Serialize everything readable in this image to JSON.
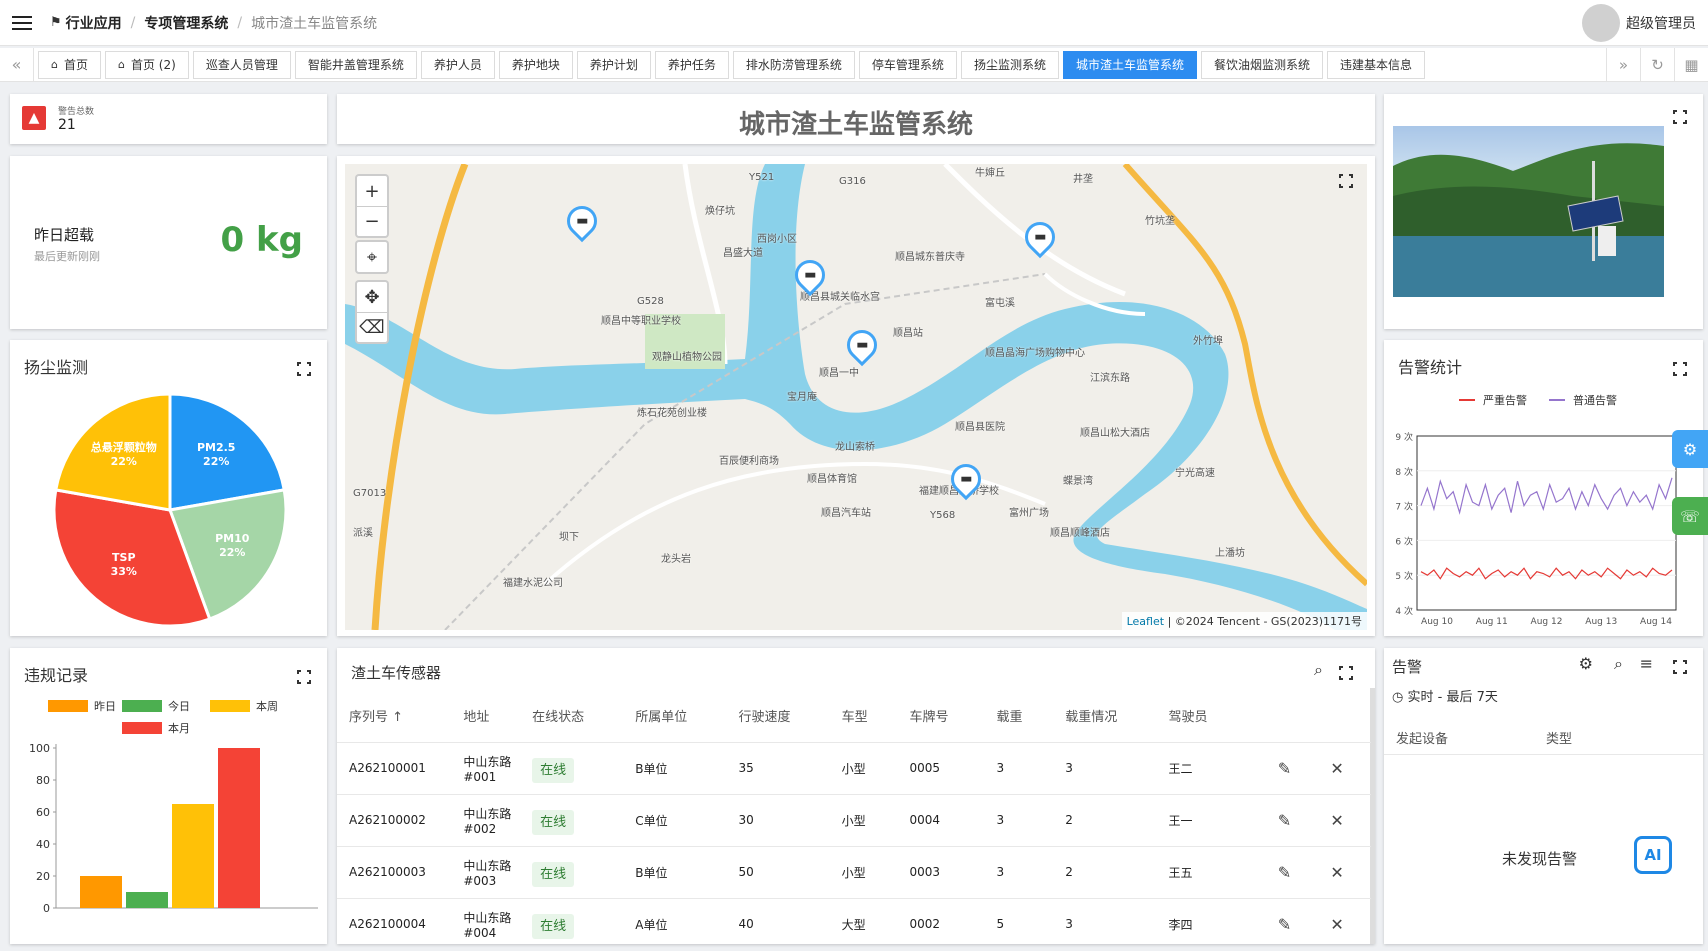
{
  "breadcrumb": [
    "行业应用",
    "专项管理系统",
    "城市渣土车监管系统"
  ],
  "user": {
    "name": "超级管理员"
  },
  "tabs": [
    "首页",
    "首页 (2)",
    "巡查人员管理",
    "智能井盖管理系统",
    "养护人员",
    "养护地块",
    "养护计划",
    "养护任务",
    "排水防涝管理系统",
    "停车管理系统",
    "扬尘监测系统",
    "城市渣土车监管系统",
    "餐饮油烟监测系统",
    "违建基本信息"
  ],
  "active_tab": "城市渣土车监管系统",
  "alarm_total": {
    "label": "警告总数",
    "value": "21"
  },
  "overload": {
    "title": "昨日超载",
    "subtitle": "最后更新刚刚",
    "value": "0 kg"
  },
  "page_title": "城市渣土车监管系统",
  "map": {
    "labels": [
      "Y521",
      "G316",
      "牛婶丘",
      "井垄",
      "竹坑垄",
      "焕仔坑",
      "西岗小区",
      "顺昌城东普庆寺",
      "顺昌县城关临水宫",
      "顺昌中等职业学校",
      "G528",
      "观静山植物公园",
      "顺昌站",
      "顺昌晶海广场购物中心",
      "外竹埠",
      "顺昌一中",
      "宝月庵",
      "炼石花苑创业楼",
      "顺昌县医院",
      "龙山索桥",
      "顺昌山松大酒店",
      "百辰便利商场",
      "顺昌体育馆",
      "蝶景湾",
      "福建顺昌金桥学校",
      "Y568",
      "富州广场",
      "顺昌汽车站",
      "顺昌顺峰酒店",
      "G7013",
      "派溪",
      "坝下",
      "龙头岩",
      "福建水泥公司",
      "上潘坊",
      "宁光高速",
      "江滨东路",
      "富屯溪",
      "昌盛大道"
    ],
    "attribution": {
      "leaflet": "Leaflet",
      "text": "| ©2024 Tencent - GS(2023)1171号"
    }
  },
  "dust": {
    "title": "扬尘监测",
    "chart_data": {
      "type": "pie",
      "categories": [
        "PM2.5",
        "PM10",
        "TSP",
        "总悬浮颗粒物"
      ],
      "values": [
        22,
        22,
        33,
        22
      ],
      "labels": [
        "22%",
        "22%",
        "33%",
        "22%"
      ],
      "colors": [
        "#2196f3",
        "#a5d6a7",
        "#f44336",
        "#ffc107"
      ]
    }
  },
  "alarm_stats": {
    "title": "告警统计",
    "chart_data": {
      "type": "line",
      "x": [
        "Aug 10",
        "Aug 11",
        "Aug 12",
        "Aug 13",
        "Aug 14"
      ],
      "ylim": [
        4,
        9
      ],
      "yticks": [
        "9 次",
        "8 次",
        "7 次",
        "6 次",
        "5 次",
        "4 次"
      ],
      "series": [
        {
          "name": "严重告警",
          "color": "#e53935",
          "values": [
            5.1,
            5.0,
            5.15,
            4.9,
            5.2,
            5.05,
            4.95,
            5.1,
            5.0,
            5.2,
            4.9,
            5.05,
            5.15,
            4.95,
            5.1,
            5.0,
            5.2,
            4.9,
            5.1,
            5.05,
            4.95,
            5.2,
            5.0,
            5.1,
            4.9,
            5.15,
            5.0,
            5.1,
            4.95,
            5.2,
            5.05,
            4.9,
            5.15,
            5.0,
            5.1,
            4.95,
            5.2,
            5.05,
            5.0,
            5.15
          ]
        },
        {
          "name": "普通告警",
          "color": "#9575cd",
          "values": [
            7.0,
            7.5,
            6.9,
            7.7,
            7.2,
            7.4,
            6.8,
            7.6,
            7.1,
            7.0,
            7.6,
            6.9,
            7.3,
            7.5,
            6.8,
            7.7,
            7.0,
            7.3,
            7.4,
            6.9,
            7.6,
            7.1,
            7.2,
            7.5,
            6.9,
            7.4,
            7.0,
            7.6,
            7.2,
            6.9,
            7.3,
            7.5,
            7.0,
            7.4,
            7.1,
            7.3,
            6.9,
            7.6,
            7.2,
            7.8
          ]
        }
      ]
    }
  },
  "violations": {
    "title": "违规记录",
    "chart_data": {
      "type": "bar",
      "categories": [
        "昨日",
        "今日",
        "本周",
        "本月"
      ],
      "values": [
        20,
        10,
        65,
        100
      ],
      "colors": [
        "#ff9800",
        "#4caf50",
        "#ffc107",
        "#f44336"
      ],
      "ylim": [
        0,
        100
      ],
      "yticks": [
        "100",
        "80",
        "60",
        "40",
        "20",
        "0"
      ]
    }
  },
  "sensors": {
    "title": "渣土车传感器",
    "columns": [
      "序列号",
      "地址",
      "在线状态",
      "所属单位",
      "行驶速度",
      "车型",
      "车牌号",
      "载重",
      "载重情况",
      "驾驶员"
    ],
    "rows": [
      {
        "id": "A262100001",
        "addr1": "中山东路",
        "addr2": "#001",
        "status": "在线",
        "unit": "B单位",
        "speed": "35",
        "type": "小型",
        "plate": "0005",
        "load": "3",
        "cond": "3",
        "driver": "王二"
      },
      {
        "id": "A262100002",
        "addr1": "中山东路",
        "addr2": "#002",
        "status": "在线",
        "unit": "C单位",
        "speed": "30",
        "type": "小型",
        "plate": "0004",
        "load": "3",
        "cond": "2",
        "driver": "王一"
      },
      {
        "id": "A262100003",
        "addr1": "中山东路",
        "addr2": "#003",
        "status": "在线",
        "unit": "B单位",
        "speed": "50",
        "type": "小型",
        "plate": "0003",
        "load": "3",
        "cond": "2",
        "driver": "王五"
      },
      {
        "id": "A262100004",
        "addr1": "中山东路",
        "addr2": "#004",
        "status": "在线",
        "unit": "A单位",
        "speed": "40",
        "type": "大型",
        "plate": "0002",
        "load": "5",
        "cond": "3",
        "driver": "李四"
      }
    ]
  },
  "alerts": {
    "title": "告警",
    "filter": "实时 - 最后 7天",
    "columns": [
      "发起设备",
      "类型"
    ],
    "empty": "未发现告警",
    "ai_label": "AI"
  }
}
